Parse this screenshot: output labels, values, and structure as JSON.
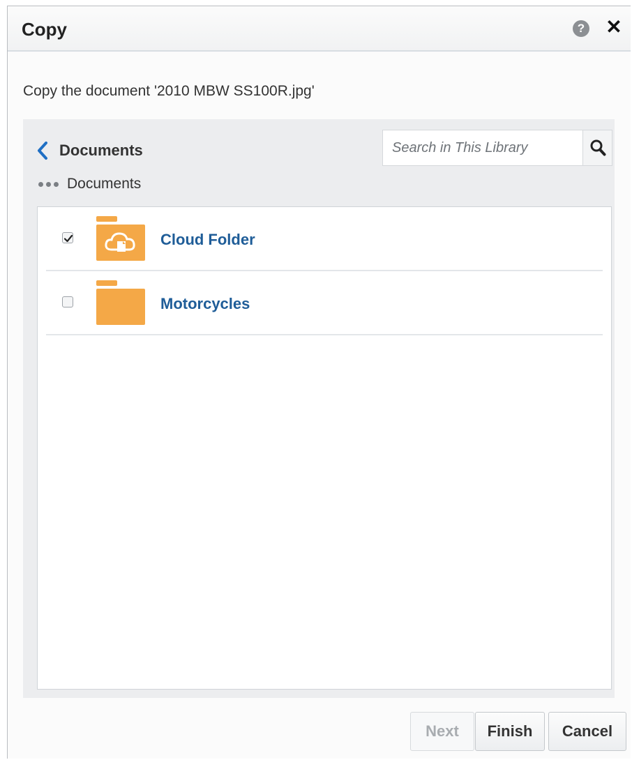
{
  "dialog": {
    "title": "Copy",
    "help_icon_label": "?",
    "close_icon_label": "✕",
    "subtitle": "Copy the document '2010 MBW SS100R.jpg'"
  },
  "browser": {
    "current_folder": "Documents",
    "breadcrumb": [
      "Documents"
    ],
    "search": {
      "placeholder": "Search in This Library",
      "value": ""
    },
    "items": [
      {
        "name": "Cloud Folder",
        "type": "cloud-folder",
        "checked": true
      },
      {
        "name": "Motorcycles",
        "type": "folder",
        "checked": false
      }
    ]
  },
  "footer": {
    "next_label": "Next",
    "finish_label": "Finish",
    "cancel_label": "Cancel"
  },
  "colors": {
    "folder": "#f4a847",
    "link": "#1f5d98",
    "back_chevron": "#1f6fc4"
  }
}
